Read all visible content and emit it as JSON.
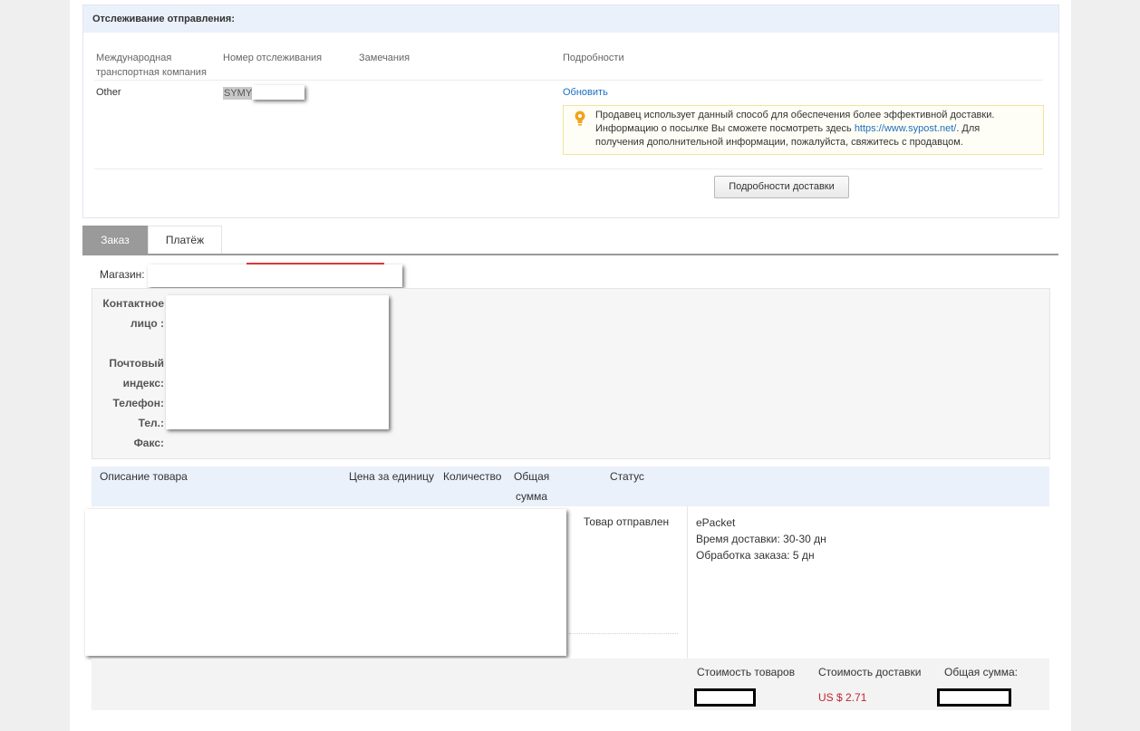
{
  "tracking": {
    "title": "Отслеживание отправления:",
    "columns": {
      "carrier": "Международная транспортная компания",
      "number": "Номер отслеживания",
      "remarks": "Замечания",
      "details": "Подробности"
    },
    "carrier_value": "Other",
    "number_prefix": "SYMY",
    "refresh_link": "Обновить",
    "notice_before": "Продавец использует данный способ для обеспечения более эффективной доставки. Информацию о посылке Вы сможете посмотреть здесь ",
    "notice_link": "https://www.sypost.net/",
    "notice_after": ". Для получения дополнительной информации, пожалуйста, свяжитесь с продавцом.",
    "notice_icon": "lightbulb-icon",
    "details_button": "Подробности доставки"
  },
  "tabs": [
    "Заказ",
    "Платёж"
  ],
  "store_label": "Магазин:",
  "contact": {
    "person_label_1": "Контактное",
    "person_label_2": "лицо :",
    "zip_label_1": "Почтовый",
    "zip_label_2": "индекс:",
    "phone_label": "Телефон:",
    "tel_label": "Тел.:",
    "fax_label": "Факс:"
  },
  "products": {
    "headers": {
      "description": "Описание товара",
      "unit_price": "Цена за единицу",
      "quantity": "Количество",
      "total_1": "Общая",
      "total_2": "сумма",
      "status": "Статус"
    },
    "status_value": "Товар отправлен",
    "shipping": {
      "method": "ePacket",
      "delivery_time": "Время доставки: 30-30 дн",
      "processing": "Обработка заказа: 5 дн"
    }
  },
  "summary": {
    "goods_cost_label": "Стоимость товаров",
    "shipping_cost_label": "Стоимость доставки",
    "total_label": "Общая сумма:",
    "shipping_cost_value": "US $ 2.71"
  },
  "colors": {
    "accent_link": "#1b6fc0",
    "price_red": "#c0272d",
    "header_blue": "#eaf1fb",
    "tab_active": "#9a9a9a"
  }
}
